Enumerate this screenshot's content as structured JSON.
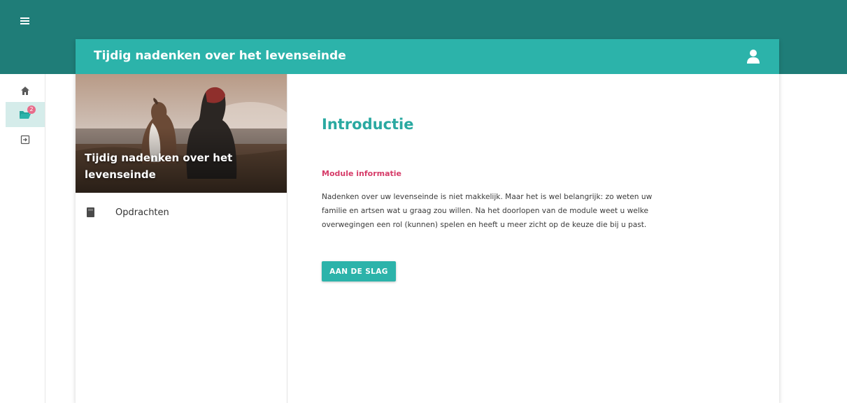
{
  "app": {
    "header_title": "Tijdig nadenken over het levenseinde",
    "theme": {
      "appbar": "#1f7d78",
      "header": "#2cb3aa",
      "accent": "#2aa9a1",
      "pink": "#d63b68"
    }
  },
  "nav": {
    "menu_icon": "hamburger-icon",
    "items": [
      {
        "icon": "home-icon",
        "active": false
      },
      {
        "icon": "folder-open-icon",
        "active": true,
        "badge": "2"
      },
      {
        "icon": "logout-icon",
        "active": false
      }
    ]
  },
  "module_panel": {
    "hero_title": "Tijdig nadenken over het levenseinde",
    "items": [
      {
        "icon": "book-icon",
        "label": "Opdrachten"
      }
    ]
  },
  "main": {
    "title": "Introductie",
    "section_label": "Module informatie",
    "body": "Nadenken over uw levenseinde is niet makkelijk. Maar het is wel belangrijk: zo weten uw familie en artsen wat u graag zou willen. Na het doorlopen van de module weet u welke overwegingen een rol (kunnen) spelen en heeft u meer zicht op de keuze die bij u past.",
    "cta_label": "AAN DE SLAG"
  }
}
